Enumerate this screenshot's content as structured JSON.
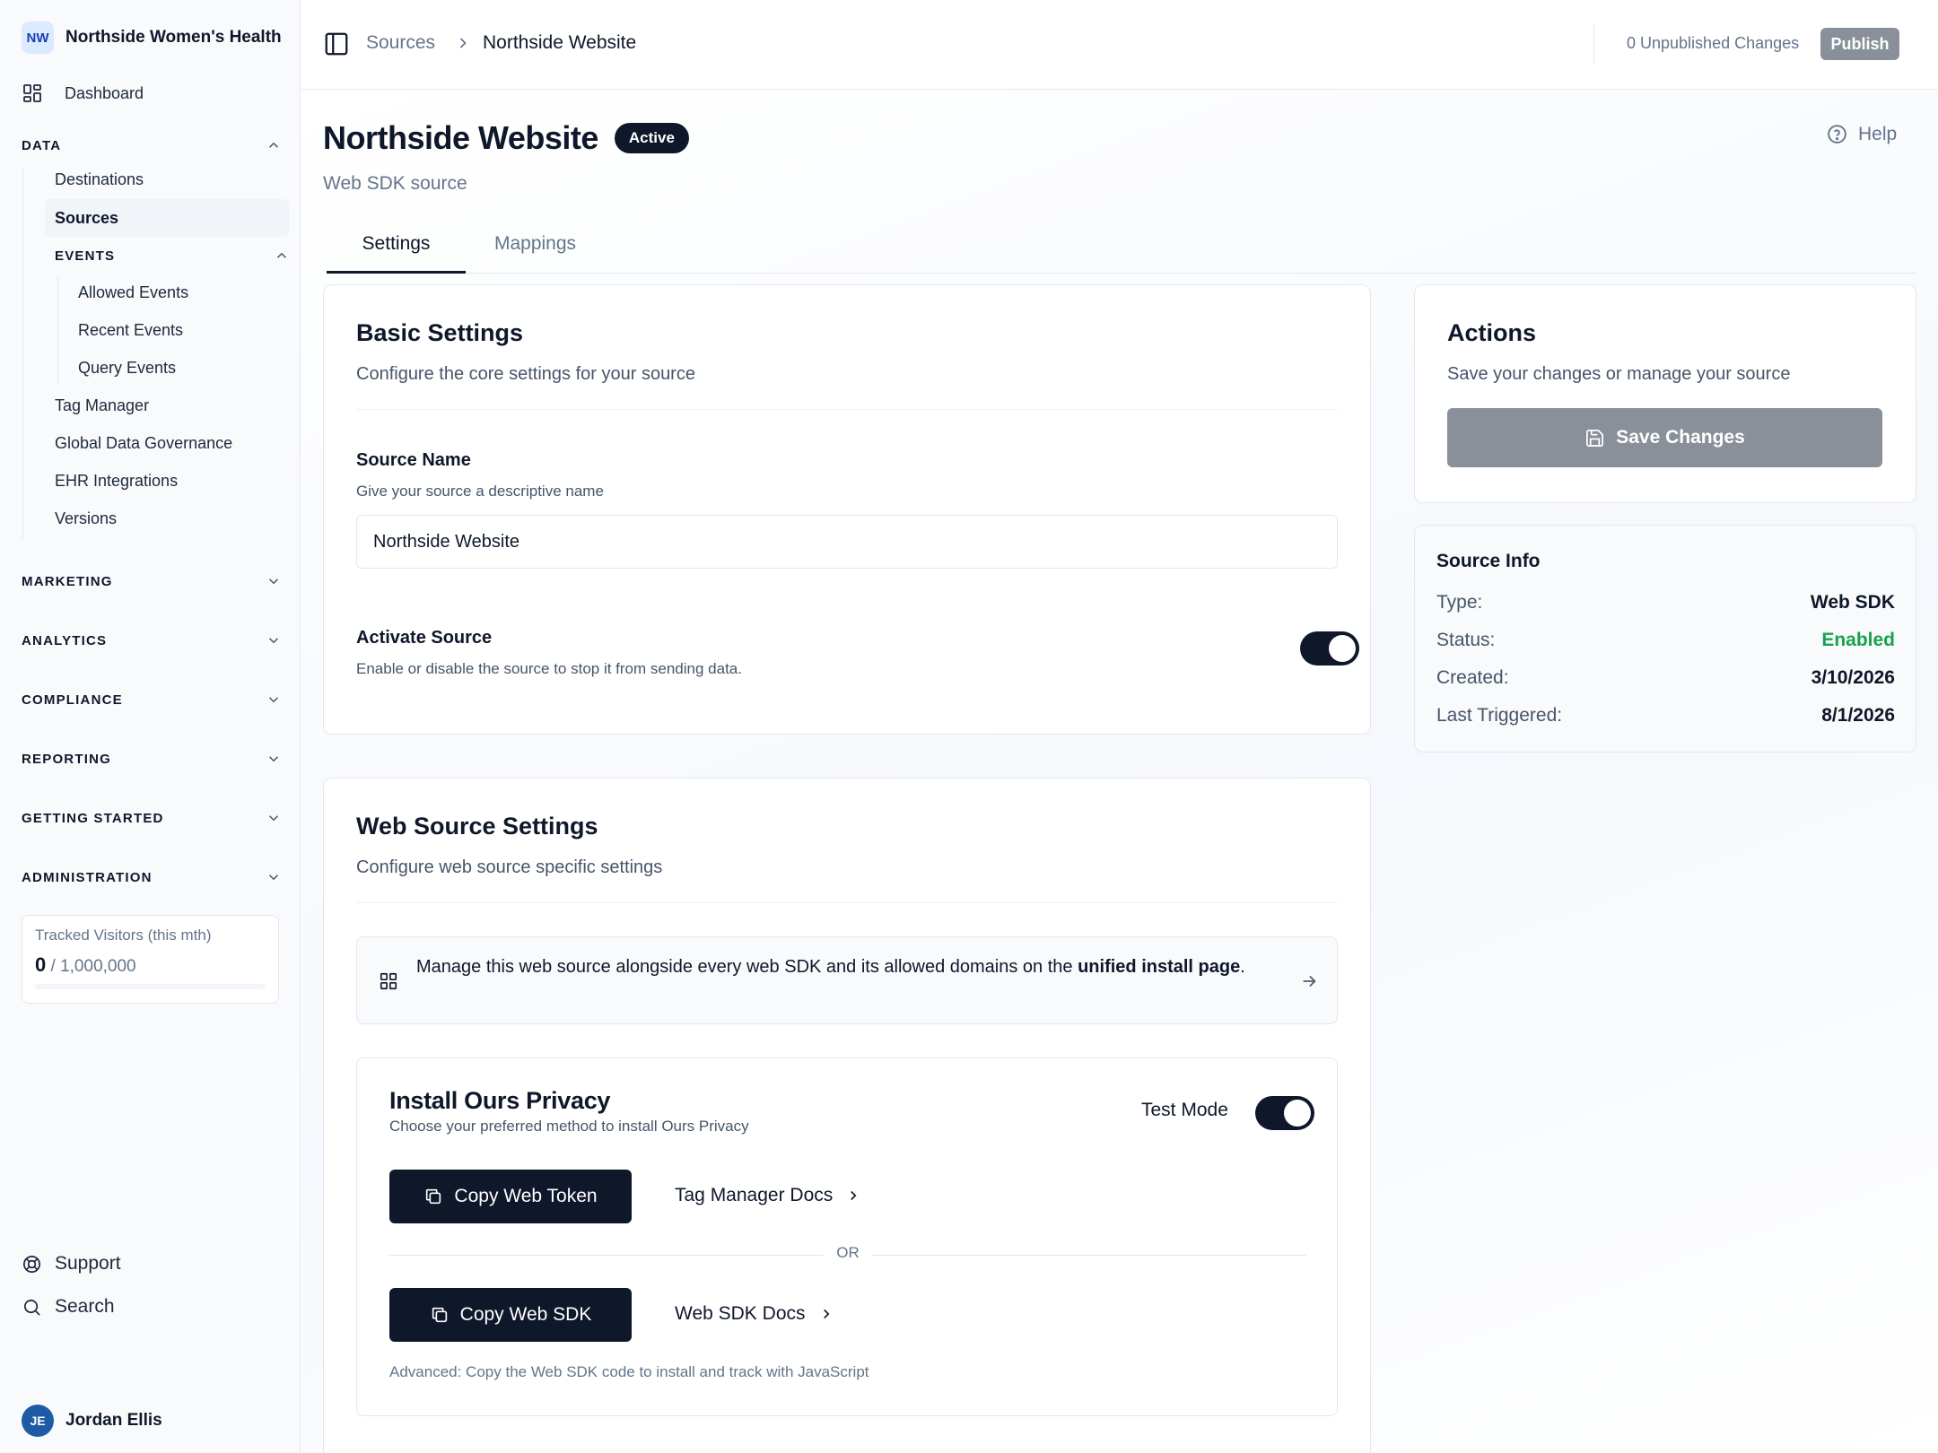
{
  "org": {
    "initials": "NW",
    "name": "Northside Women's Health"
  },
  "nav": {
    "dashboard": "Dashboard",
    "data_section": "DATA",
    "data_items": [
      "Destinations",
      "Sources"
    ],
    "events_section": "EVENTS",
    "events_items": [
      "Allowed Events",
      "Recent Events",
      "Query Events"
    ],
    "data_more": [
      "Tag Manager",
      "Global Data Governance",
      "EHR Integrations",
      "Versions"
    ],
    "sections": [
      "MARKETING",
      "ANALYTICS",
      "COMPLIANCE",
      "REPORTING",
      "GETTING STARTED",
      "ADMINISTRATION"
    ],
    "active_item": "Sources"
  },
  "usage": {
    "label": "Tracked Visitors (this mth)",
    "used": "0",
    "limit": " / 1,000,000",
    "fraction": 0
  },
  "footer": {
    "support": "Support",
    "search": "Search"
  },
  "user": {
    "initials": "JE",
    "name": "Jordan Ellis"
  },
  "topbar": {
    "breadcrumb": [
      "Sources",
      "Northside Website"
    ],
    "unpublished": "0 Unpublished Changes",
    "publish": "Publish"
  },
  "page": {
    "title": "Northside Website",
    "status_badge": "Active",
    "subtitle": "Web SDK source",
    "help": "Help",
    "tabs": [
      "Settings",
      "Mappings"
    ],
    "active_tab": "Settings"
  },
  "basic_settings": {
    "title": "Basic Settings",
    "subtitle": "Configure the core settings for your source",
    "source_name_label": "Source Name",
    "source_name_help": "Give your source a descriptive name",
    "source_name_value": "Northside Website",
    "activate_label": "Activate Source",
    "activate_help": "Enable or disable the source to stop it from sending data.",
    "activate_on": true
  },
  "web_settings": {
    "title": "Web Source Settings",
    "subtitle": "Configure web source specific settings",
    "notice_prefix": "Manage this web source alongside every web SDK and its allowed domains on the ",
    "notice_bold": "unified install page",
    "notice_suffix": "."
  },
  "install": {
    "title": "Install Ours Privacy",
    "subtitle": "Choose your preferred method to install Ours Privacy",
    "test_mode_label": "Test Mode",
    "test_mode_on": true,
    "copy_token": "Copy Web Token",
    "tag_manager_docs": "Tag Manager Docs",
    "or": "OR",
    "copy_sdk": "Copy Web SDK",
    "sdk_docs": "Web SDK Docs",
    "advanced": "Advanced: Copy the Web SDK code to install and track with JavaScript"
  },
  "actions": {
    "title": "Actions",
    "subtitle": "Save your changes or manage your source",
    "save": "Save Changes"
  },
  "source_info": {
    "title": "Source Info",
    "rows": [
      {
        "key": "Type:",
        "value": "Web SDK"
      },
      {
        "key": "Status:",
        "value": "Enabled"
      },
      {
        "key": "Created:",
        "value": "3/10/2026"
      },
      {
        "key": "Last Triggered:",
        "value": "8/1/2026"
      }
    ],
    "status_color": "#16a34a"
  },
  "colors": {
    "primary": "#0f172a",
    "disabled_button": "#8a9099",
    "muted_text": "#64748b",
    "border": "#e2e8f0"
  }
}
